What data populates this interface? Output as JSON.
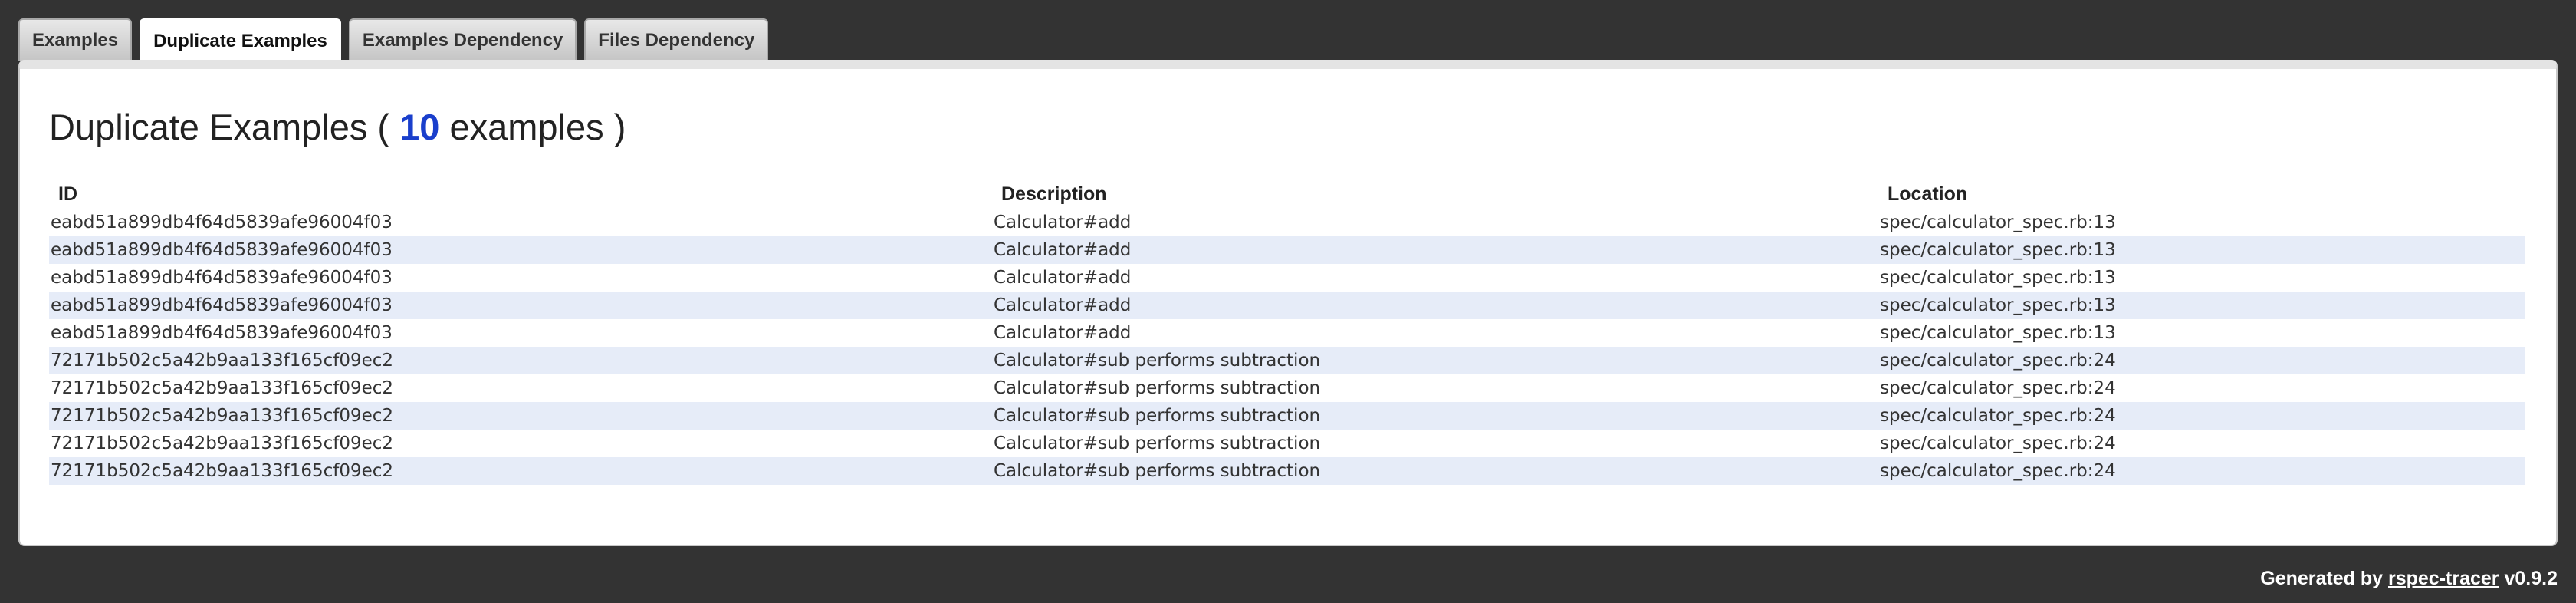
{
  "tabs": [
    {
      "label": "Examples",
      "active": false
    },
    {
      "label": "Duplicate Examples",
      "active": true
    },
    {
      "label": "Examples Dependency",
      "active": false
    },
    {
      "label": "Files Dependency",
      "active": false
    }
  ],
  "page": {
    "title_prefix": "Duplicate Examples (",
    "count": "10",
    "title_suffix": "examples )"
  },
  "table": {
    "headers": [
      "ID",
      "Description",
      "Location"
    ],
    "rows": [
      [
        "eabd51a899db4f64d5839afe96004f03",
        "Calculator#add",
        "spec/calculator_spec.rb:13"
      ],
      [
        "eabd51a899db4f64d5839afe96004f03",
        "Calculator#add",
        "spec/calculator_spec.rb:13"
      ],
      [
        "eabd51a899db4f64d5839afe96004f03",
        "Calculator#add",
        "spec/calculator_spec.rb:13"
      ],
      [
        "eabd51a899db4f64d5839afe96004f03",
        "Calculator#add",
        "spec/calculator_spec.rb:13"
      ],
      [
        "eabd51a899db4f64d5839afe96004f03",
        "Calculator#add",
        "spec/calculator_spec.rb:13"
      ],
      [
        "72171b502c5a42b9aa133f165cf09ec2",
        "Calculator#sub performs subtraction",
        "spec/calculator_spec.rb:24"
      ],
      [
        "72171b502c5a42b9aa133f165cf09ec2",
        "Calculator#sub performs subtraction",
        "spec/calculator_spec.rb:24"
      ],
      [
        "72171b502c5a42b9aa133f165cf09ec2",
        "Calculator#sub performs subtraction",
        "spec/calculator_spec.rb:24"
      ],
      [
        "72171b502c5a42b9aa133f165cf09ec2",
        "Calculator#sub performs subtraction",
        "spec/calculator_spec.rb:24"
      ],
      [
        "72171b502c5a42b9aa133f165cf09ec2",
        "Calculator#sub performs subtraction",
        "spec/calculator_spec.rb:24"
      ]
    ]
  },
  "footer": {
    "prefix": "Generated by",
    "link": "rspec-tracer",
    "version": "v0.9.2"
  },
  "colors": {
    "background": "#333333",
    "count_accent": "#1a3fcc",
    "row_stripe": "#e6ecf8"
  }
}
